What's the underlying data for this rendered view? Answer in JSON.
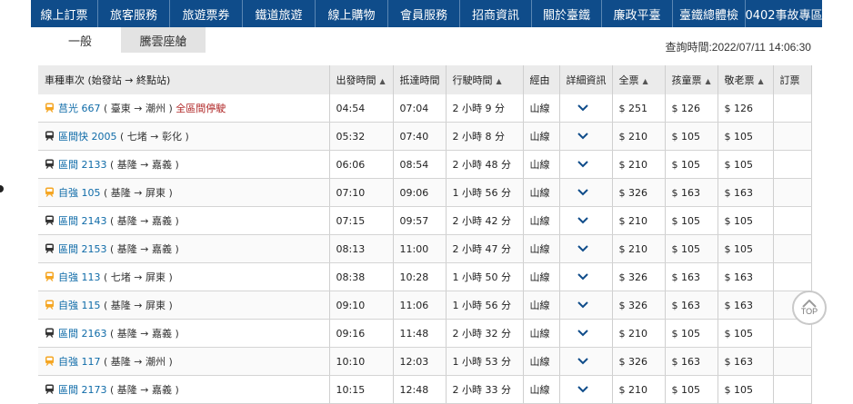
{
  "nav": [
    "線上訂票",
    "旅客服務",
    "旅遊票券",
    "鐵道旅遊",
    "線上購物",
    "會員服務",
    "招商資訊",
    "關於臺鐵",
    "廉政平臺",
    "臺鐵總體檢",
    "0402事故專區"
  ],
  "tabs": {
    "general": "一般",
    "cloud": "騰雲座艙"
  },
  "query_time": "查詢時間:2022/07/11 14:06:30",
  "headers": {
    "train": "車種車次 (始發站 → 終點站)",
    "dep": "出發時間",
    "arr": "抵達時間",
    "dur": "行駛時間",
    "via": "經由",
    "detail": "詳細資訊",
    "full": "全票",
    "child": "孩童票",
    "senior": "敬老票",
    "book": "訂票"
  },
  "top_label": "TOP",
  "colors": {
    "nav_bg": "#0f4c8a",
    "icon_express": "#f5a623",
    "icon_local": "#333333",
    "link": "#0f6ba8",
    "note": "#b02727"
  },
  "trains": [
    {
      "icon": "express",
      "name": "莒光 667",
      "route": "( 臺東 → 潮州 )",
      "note": "全區間停駛",
      "dep": "04:54",
      "arr": "07:04",
      "dur": "2 小時 9 分",
      "via": "山線",
      "full": "$ 251",
      "child": "$ 126",
      "senior": "$ 126"
    },
    {
      "icon": "local",
      "name": "區間快 2005",
      "route": "( 七堵 → 彰化 )",
      "note": "",
      "dep": "05:32",
      "arr": "07:40",
      "dur": "2 小時 8 分",
      "via": "山線",
      "full": "$ 210",
      "child": "$ 105",
      "senior": "$ 105"
    },
    {
      "icon": "local",
      "name": "區間 2133",
      "route": "( 基隆 → 嘉義 )",
      "note": "",
      "dep": "06:06",
      "arr": "08:54",
      "dur": "2 小時 48 分",
      "via": "山線",
      "full": "$ 210",
      "child": "$ 105",
      "senior": "$ 105"
    },
    {
      "icon": "express",
      "name": "自強 105",
      "route": "( 基隆 → 屏東 )",
      "note": "",
      "dep": "07:10",
      "arr": "09:06",
      "dur": "1 小時 56 分",
      "via": "山線",
      "full": "$ 326",
      "child": "$ 163",
      "senior": "$ 163"
    },
    {
      "icon": "local",
      "name": "區間 2143",
      "route": "( 基隆 → 嘉義 )",
      "note": "",
      "dep": "07:15",
      "arr": "09:57",
      "dur": "2 小時 42 分",
      "via": "山線",
      "full": "$ 210",
      "child": "$ 105",
      "senior": "$ 105"
    },
    {
      "icon": "local",
      "name": "區間 2153",
      "route": "( 基隆 → 嘉義 )",
      "note": "",
      "dep": "08:13",
      "arr": "11:00",
      "dur": "2 小時 47 分",
      "via": "山線",
      "full": "$ 210",
      "child": "$ 105",
      "senior": "$ 105"
    },
    {
      "icon": "express",
      "name": "自強 113",
      "route": "( 七堵 → 屏東 )",
      "note": "",
      "dep": "08:38",
      "arr": "10:28",
      "dur": "1 小時 50 分",
      "via": "山線",
      "full": "$ 326",
      "child": "$ 163",
      "senior": "$ 163"
    },
    {
      "icon": "express",
      "name": "自強 115",
      "route": "( 基隆 → 屏東 )",
      "note": "",
      "dep": "09:10",
      "arr": "11:06",
      "dur": "1 小時 56 分",
      "via": "山線",
      "full": "$ 326",
      "child": "$ 163",
      "senior": "$ 163"
    },
    {
      "icon": "local",
      "name": "區間 2163",
      "route": "( 基隆 → 嘉義 )",
      "note": "",
      "dep": "09:16",
      "arr": "11:48",
      "dur": "2 小時 32 分",
      "via": "山線",
      "full": "$ 210",
      "child": "$ 105",
      "senior": "$ 105"
    },
    {
      "icon": "express",
      "name": "自強 117",
      "route": "( 基隆 → 潮州 )",
      "note": "",
      "dep": "10:10",
      "arr": "12:03",
      "dur": "1 小時 53 分",
      "via": "山線",
      "full": "$ 326",
      "child": "$ 163",
      "senior": "$ 163"
    },
    {
      "icon": "local",
      "name": "區間 2173",
      "route": "( 基隆 → 嘉義 )",
      "note": "",
      "dep": "10:15",
      "arr": "12:48",
      "dur": "2 小時 33 分",
      "via": "山線",
      "full": "$ 210",
      "child": "$ 105",
      "senior": "$ 105"
    }
  ]
}
